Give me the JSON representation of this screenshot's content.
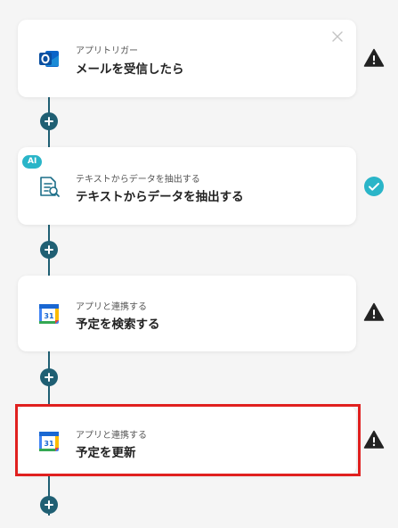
{
  "steps": [
    {
      "subtitle": "アプリトリガー",
      "title": "メールを受信したら",
      "icon": "outlook-icon",
      "status": "warning"
    },
    {
      "subtitle": "テキストからデータを抽出する",
      "title": "テキストからデータを抽出する",
      "icon": "document-search-icon",
      "badge": "AI",
      "status": "success"
    },
    {
      "subtitle": "アプリと連携する",
      "title": "予定を検索する",
      "icon": "google-calendar-icon",
      "status": "warning"
    },
    {
      "subtitle": "アプリと連携する",
      "title": "予定を更新",
      "icon": "google-calendar-icon",
      "status": "warning",
      "selected": true
    }
  ],
  "calendar_day": "31",
  "colors": {
    "connector": "#1f5f73",
    "warning": "#222222",
    "success": "#2ab5c8",
    "selected_border": "#e0201f",
    "ai_badge": "#2ab5c8"
  }
}
